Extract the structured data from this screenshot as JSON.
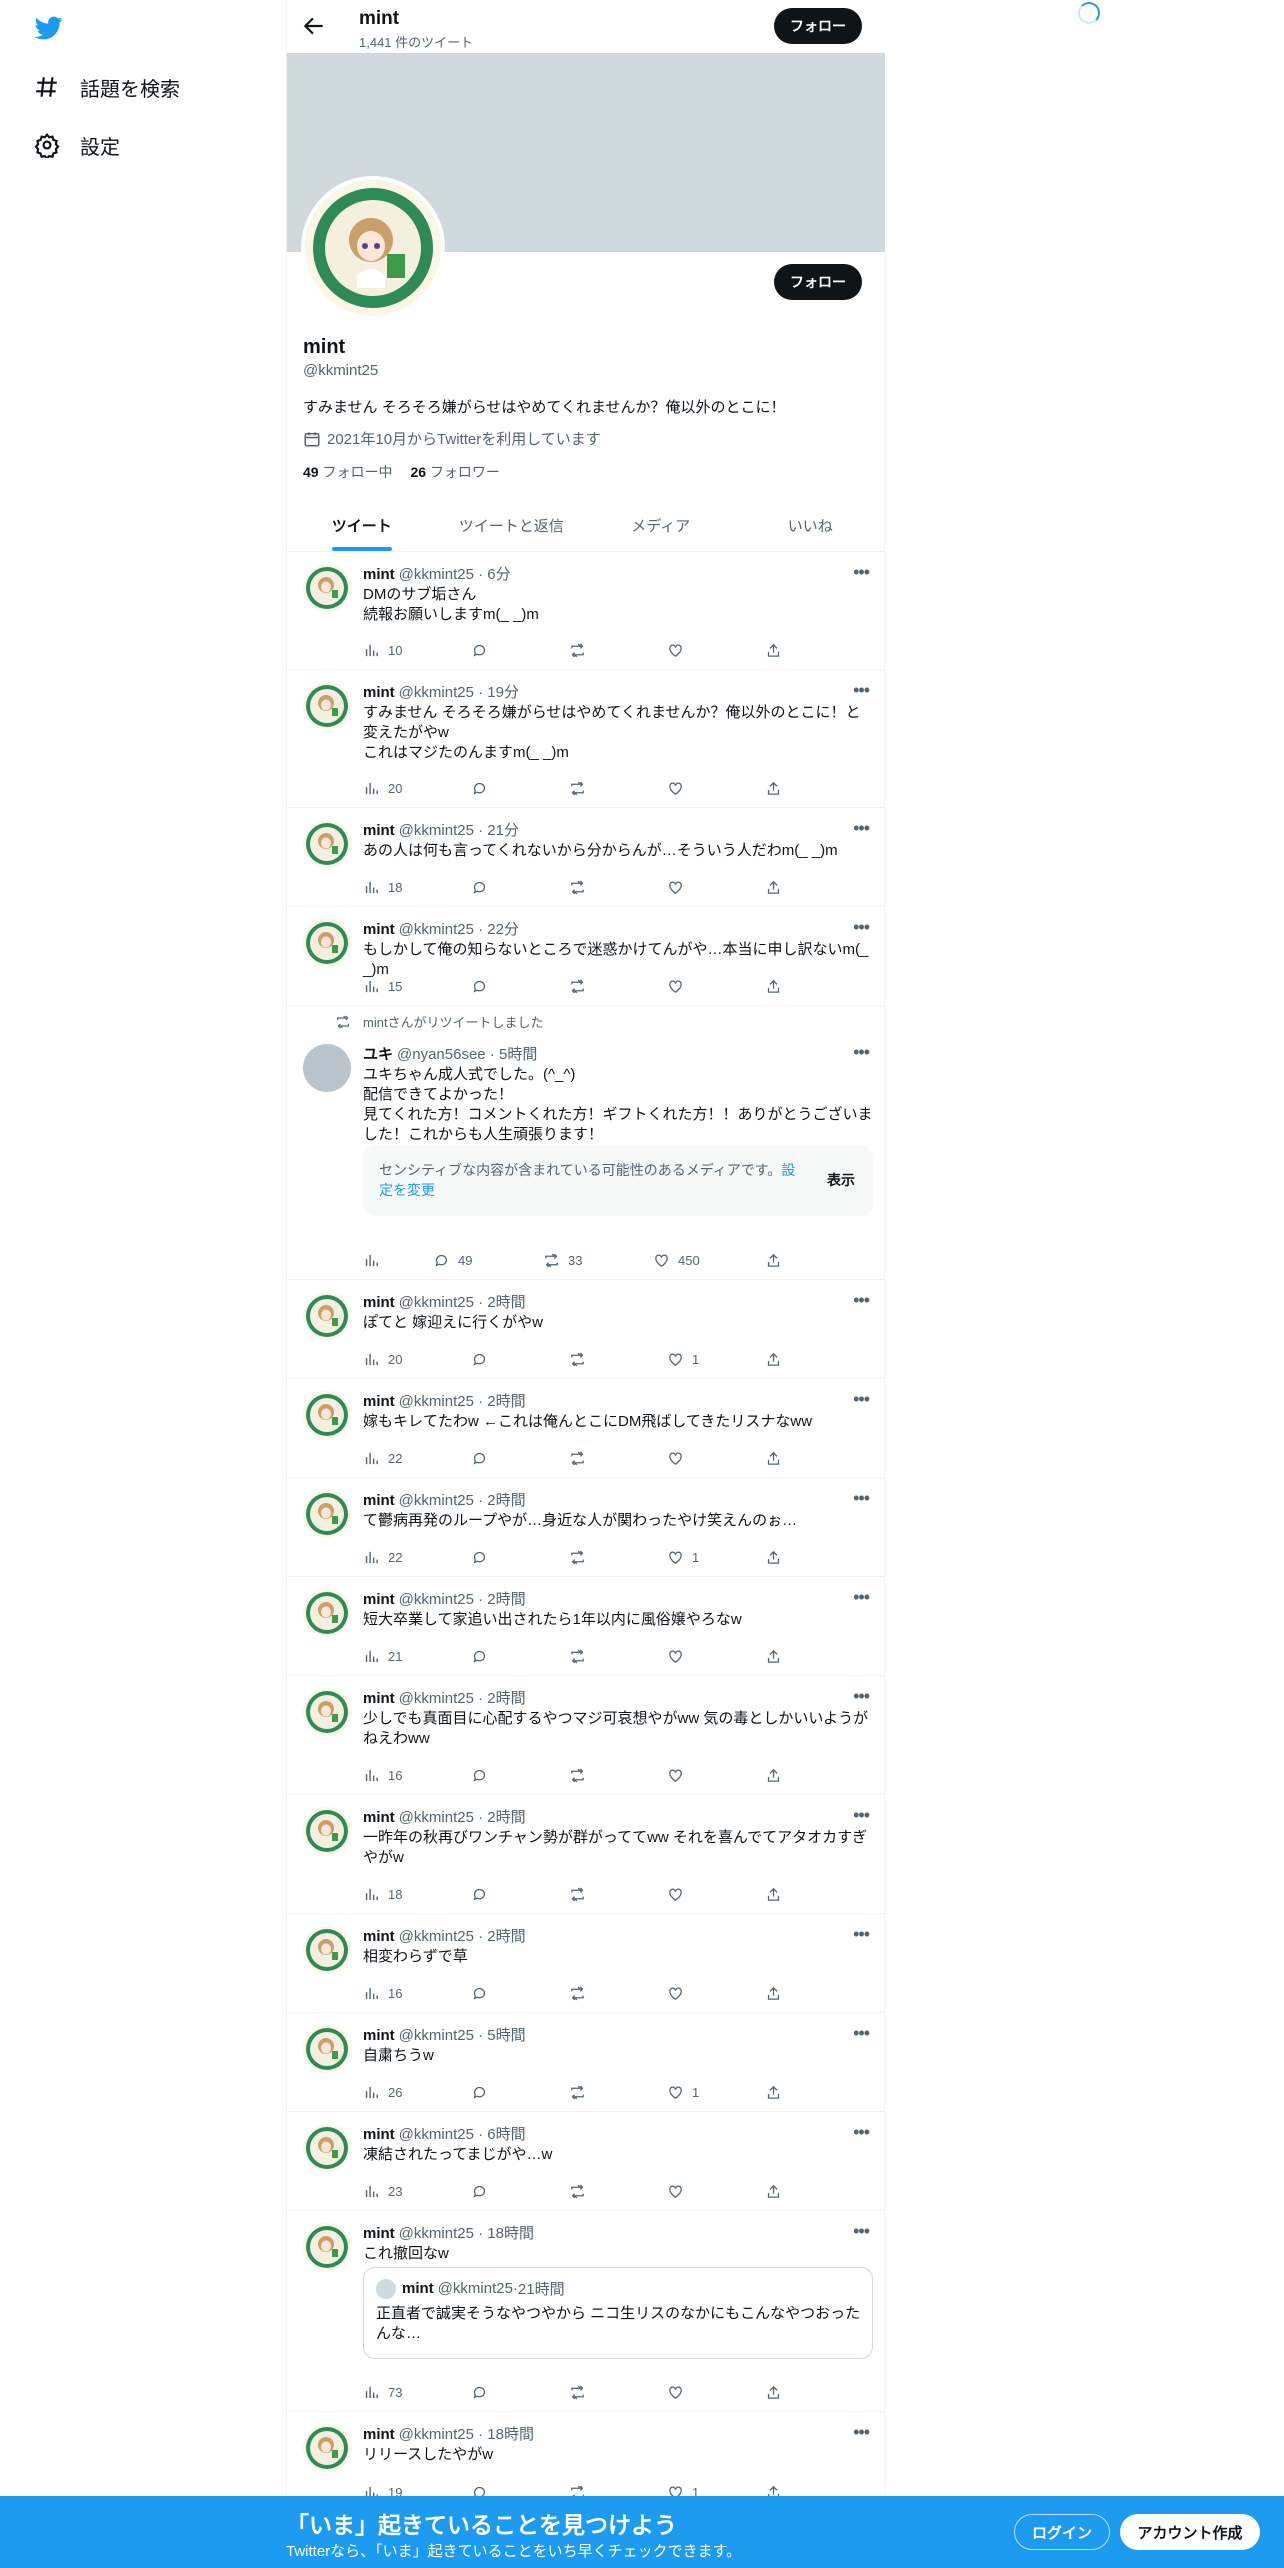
{
  "nav": {
    "explore_label": "話題を検索",
    "settings_label": "設定"
  },
  "colors": {
    "accent": "#1d9bf0",
    "text": "#0f1419",
    "muted": "#536471",
    "banner": "#cfd9de"
  },
  "header": {
    "name": "mint",
    "tweet_count": "1,441 件のツイート",
    "follow_label": "フォロー"
  },
  "profile": {
    "name": "mint",
    "handle": "@kkmint25",
    "bio": "すみません そろそろ嫌がらせはやめてくれませんか？俺以外のとこに！",
    "joined": "2021年10月からTwitterを利用しています",
    "following_count": "49",
    "following_label": "フォロー中",
    "followers_count": "26",
    "followers_label": "フォロワー",
    "follow_label": "フォロー"
  },
  "tabs": [
    "ツイート",
    "ツイートと返信",
    "メディア",
    "いいね"
  ],
  "tweets": [
    {
      "name": "mint",
      "handle": "@kkmint25",
      "time": "6分",
      "lines": [
        "DMのサブ垢さん",
        "続報お願いしますm(_ _)m"
      ],
      "views": "10",
      "replies": "",
      "retweets": "",
      "likes": ""
    },
    {
      "name": "mint",
      "handle": "@kkmint25",
      "time": "19分",
      "lines": [
        "すみません そろそろ嫌がらせはやめてくれませんか？俺以外のとこに！と変えたがやw",
        "これはマジたのんますm(_ _)m"
      ],
      "views": "20",
      "replies": "",
      "retweets": "",
      "likes": ""
    },
    {
      "name": "mint",
      "handle": "@kkmint25",
      "time": "21分",
      "lines": [
        "あの人は何も言ってくれないから分からんが…そういう人だわm(_ _)m"
      ],
      "views": "18",
      "replies": "",
      "retweets": "",
      "likes": ""
    },
    {
      "name": "mint",
      "handle": "@kkmint25",
      "time": "22分",
      "lines": [
        "もしかして俺の知らないところで迷惑かけてんがや…本当に申し訳ないm(_ _)m"
      ],
      "views": "15",
      "replies": "",
      "retweets": "",
      "likes": ""
    },
    {
      "name": "ユキ",
      "handle": "@nyan56see",
      "time": "5時間",
      "retweeted_by": "mintさんがリツイートしました",
      "lines": [
        "ユキちゃん成人式でした。(^_^)",
        "配信できてよかった！",
        "見てくれた方！コメントくれた方！ギフトくれた方！！ありがとうございました！これからも人生頑張ります！"
      ],
      "sensitive": {
        "text": "センシティブな内容が含まれている可能性のあるメディアです。",
        "link": "設定を変更",
        "show": "表示"
      },
      "views": "",
      "replies": "49",
      "retweets": "33",
      "likes": "450"
    },
    {
      "name": "mint",
      "handle": "@kkmint25",
      "time": "2時間",
      "lines": [
        "ぽてと 嫁迎えに行くがやw"
      ],
      "views": "20",
      "replies": "",
      "retweets": "",
      "likes": "1"
    },
    {
      "name": "mint",
      "handle": "@kkmint25",
      "time": "2時間",
      "lines": [
        "嫁もキレてたわw ←これは俺んとこにDM飛ばしてきたリスナなww"
      ],
      "views": "22",
      "replies": "",
      "retweets": "",
      "likes": ""
    },
    {
      "name": "mint",
      "handle": "@kkmint25",
      "time": "2時間",
      "lines": [
        "て鬱病再発のループやが…身近な人が関わったやけ笑えんのぉ…"
      ],
      "views": "22",
      "replies": "",
      "retweets": "",
      "likes": "1"
    },
    {
      "name": "mint",
      "handle": "@kkmint25",
      "time": "2時間",
      "lines": [
        "短大卒業して家追い出されたら1年以内に風俗嬢やろなw"
      ],
      "views": "21",
      "replies": "",
      "retweets": "",
      "likes": ""
    },
    {
      "name": "mint",
      "handle": "@kkmint25",
      "time": "2時間",
      "lines": [
        "少しでも真面目に心配するやつマジ可哀想やがww 気の毒としかいいようがねえわww"
      ],
      "views": "16",
      "replies": "",
      "retweets": "",
      "likes": ""
    },
    {
      "name": "mint",
      "handle": "@kkmint25",
      "time": "2時間",
      "lines": [
        "一昨年の秋再びワンチャン勢が群がっててww それを喜んでてアタオカすぎやがw"
      ],
      "views": "18",
      "replies": "",
      "retweets": "",
      "likes": ""
    },
    {
      "name": "mint",
      "handle": "@kkmint25",
      "time": "2時間",
      "lines": [
        "相変わらずで草"
      ],
      "views": "16",
      "replies": "",
      "retweets": "",
      "likes": ""
    },
    {
      "name": "mint",
      "handle": "@kkmint25",
      "time": "5時間",
      "lines": [
        "自粛ちうw"
      ],
      "views": "26",
      "replies": "",
      "retweets": "",
      "likes": "1"
    },
    {
      "name": "mint",
      "handle": "@kkmint25",
      "time": "6時間",
      "lines": [
        "凍結されたってまじがや…w"
      ],
      "views": "23",
      "replies": "",
      "retweets": "",
      "likes": ""
    },
    {
      "name": "mint",
      "handle": "@kkmint25",
      "time": "18時間",
      "lines": [
        "これ撤回なw"
      ],
      "quote": {
        "name": "mint",
        "handle": "@kkmint25",
        "time": "21時間",
        "text": "正直者で誠実そうなやつやから ニコ生リスのなかにもこんなやつおったんな…"
      },
      "views": "73",
      "replies": "",
      "retweets": "",
      "likes": ""
    },
    {
      "name": "mint",
      "handle": "@kkmint25",
      "time": "18時間",
      "lines": [
        "リリースしたやがw"
      ],
      "views": "19",
      "replies": "",
      "retweets": "",
      "likes": "1"
    }
  ],
  "bottom": {
    "title": "「いま」起きていることを見つけよう",
    "subtitle": "Twitterなら、「いま」起きていることをいち早くチェックできます。",
    "login": "ログイン",
    "signup": "アカウント作成"
  }
}
